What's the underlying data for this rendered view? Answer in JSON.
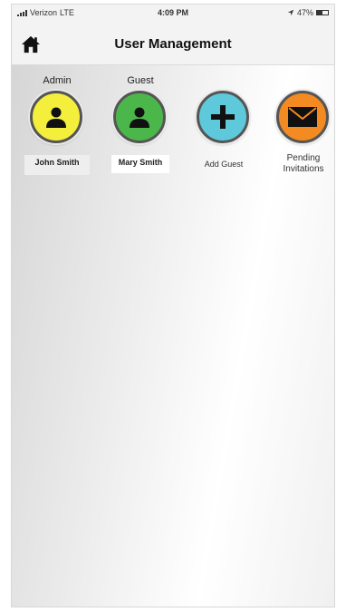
{
  "status_bar": {
    "carrier": "Verizon",
    "network": "LTE",
    "time": "4:09 PM",
    "battery": "47%",
    "battery_level": 0.47
  },
  "nav": {
    "title": "User Management",
    "home_icon": "home-icon"
  },
  "users": [
    {
      "role": "Admin",
      "name": "John Smith",
      "icon": "person-icon",
      "color": "#f4ee3c"
    },
    {
      "role": "Guest",
      "name": "Mary Smith",
      "icon": "person-icon",
      "color": "#4bb74b"
    }
  ],
  "actions": [
    {
      "label": "Add Guest",
      "icon": "plus-icon",
      "color": "#5fc9dc"
    },
    {
      "label_line1": "Pending",
      "label_line2": "Invitations",
      "icon": "envelope-icon",
      "color": "#f48a22"
    }
  ]
}
